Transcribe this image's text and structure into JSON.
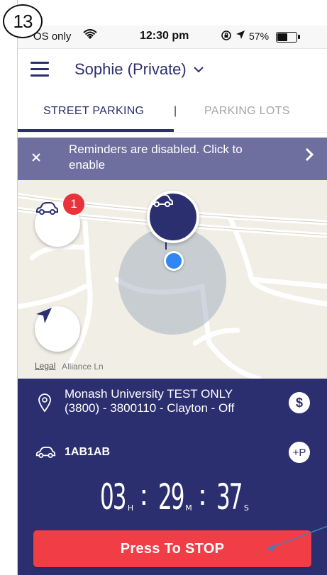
{
  "step_number": "13",
  "status_bar": {
    "carrier": "OS only",
    "time": "12:30 pm",
    "battery": "57%",
    "battery_level": 0.57
  },
  "header": {
    "account_name": "Sophie (Private)"
  },
  "tabs": [
    {
      "label": "STREET PARKING",
      "active": true
    },
    {
      "label": "PARKING LOTS",
      "active": false
    }
  ],
  "tab_separator": "|",
  "banner": {
    "text": "Reminders are disabled. Click to enable"
  },
  "map": {
    "vehicle_count_badge": "1",
    "legal_link": "Legal",
    "street_name": "Alliance Ln"
  },
  "session": {
    "location_line1": "Monash University TEST ONLY",
    "location_line2": "(3800) - 3800110 - Clayton - Off",
    "plate": "1AB1AB",
    "plus_p": "+P",
    "dollar": "$",
    "timer": {
      "hours": "03",
      "hours_unit": "H",
      "minutes": "29",
      "minutes_unit": "M",
      "seconds": "37",
      "seconds_unit": "S",
      "separator": ":"
    },
    "stop_button": "Press To STOP"
  },
  "colors": {
    "brand_navy": "#2c2f6f",
    "banner": "#6e6f9f",
    "stop_red": "#f03d46",
    "badge_red": "#e8323c",
    "location_blue": "#2f86f5"
  }
}
